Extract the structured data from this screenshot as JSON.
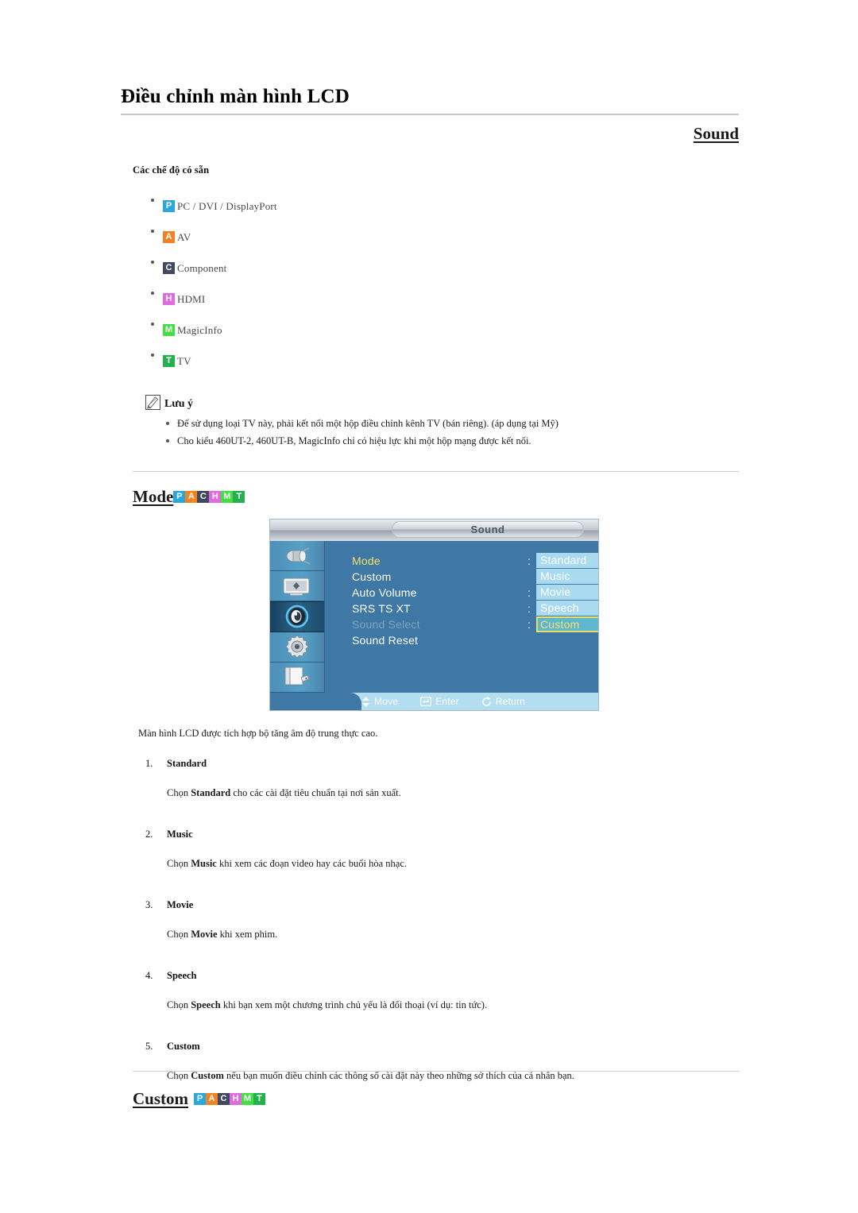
{
  "header": {
    "title": "Điều chỉnh màn hình LCD",
    "section_title": "Sound"
  },
  "available_modes": {
    "heading": "Các chế độ có sẵn",
    "items": [
      {
        "badge": "P",
        "color": "#29a8df",
        "label": "PC / DVI / DisplayPort"
      },
      {
        "badge": "A",
        "color": "#f58220",
        "label": "AV"
      },
      {
        "badge": "C",
        "color": "#41495e",
        "label": "Component"
      },
      {
        "badge": "H",
        "color": "#e06ae0",
        "label": "HDMI"
      },
      {
        "badge": "M",
        "color": "#3fe03f",
        "label": "MagicInfo"
      },
      {
        "badge": "T",
        "color": "#23b14d",
        "label": "TV"
      }
    ]
  },
  "note": {
    "icon": "note-pencil-icon",
    "title": "Lưu ý",
    "items": [
      "Để sử dụng loại TV này, phải kết nối một hộp điều chỉnh kênh TV (bán riêng). (áp dụng tại Mỹ)",
      "Cho kiểu 460UT-2, 460UT-B, MagicInfo chỉ có hiệu lực khi một hộp mạng được kết nối."
    ]
  },
  "badge_set": [
    {
      "letter": "P",
      "color": "#29a8df"
    },
    {
      "letter": "A",
      "color": "#f58220"
    },
    {
      "letter": "C",
      "color": "#41495e"
    },
    {
      "letter": "H",
      "color": "#e06ae0"
    },
    {
      "letter": "M",
      "color": "#3fe03f"
    },
    {
      "letter": "T",
      "color": "#23b14d"
    }
  ],
  "mode_section": {
    "heading": "Mode",
    "intro": "Màn hình LCD được tích hợp bộ tăng âm độ trung thực cao.",
    "items": [
      {
        "index": "1.",
        "name": "Standard",
        "desc_before": "Chọn ",
        "desc_bold": "Standard",
        "desc_after": " cho các cài đặt tiêu chuẩn tại nơi sản xuất."
      },
      {
        "index": "2.",
        "name": "Music",
        "desc_before": "Chọn ",
        "desc_bold": "Music",
        "desc_after": " khi xem các đoạn video hay các buổi hòa nhạc."
      },
      {
        "index": "3.",
        "name": "Movie",
        "desc_before": "Chọn ",
        "desc_bold": "Movie",
        "desc_after": " khi xem phim."
      },
      {
        "index": "4.",
        "name": "Speech",
        "desc_before": "Chọn ",
        "desc_bold": "Speech",
        "desc_after": " khi bạn xem một chương trình chủ yếu là đối thoại (ví dụ: tin tức)."
      },
      {
        "index": "5.",
        "name": "Custom",
        "desc_before": "Chọn ",
        "desc_bold": "Custom",
        "desc_after": " nếu bạn muốn điều chỉnh các thông số cài đặt này theo những sở thích của cá nhân bạn."
      }
    ]
  },
  "custom_section": {
    "heading": "Custom"
  },
  "osd": {
    "title": "Sound",
    "sidebar_icons": [
      "input-source-icon",
      "picture-icon",
      "sound-icon",
      "setup-gear-icon",
      "multi-control-icon"
    ],
    "active_sidebar_index": 2,
    "menu_rows": [
      {
        "label": "Mode",
        "state": "selected",
        "colon": ":"
      },
      {
        "label": "Custom",
        "state": "normal",
        "colon": ""
      },
      {
        "label": "Auto Volume",
        "state": "normal",
        "colon": ":"
      },
      {
        "label": "SRS TS XT",
        "state": "normal",
        "colon": ":"
      },
      {
        "label": "Sound Select",
        "state": "disabled",
        "colon": ":"
      },
      {
        "label": "Sound Reset",
        "state": "normal",
        "colon": ""
      }
    ],
    "options": [
      {
        "label": "Standard",
        "selected": false
      },
      {
        "label": "Music",
        "selected": false
      },
      {
        "label": "Movie",
        "selected": false
      },
      {
        "label": "Speech",
        "selected": false
      },
      {
        "label": "Custom",
        "selected": true
      }
    ],
    "footer": [
      {
        "icon": "move-updown-icon",
        "label": "Move"
      },
      {
        "icon": "enter-key-icon",
        "label": "Enter"
      },
      {
        "icon": "return-arrow-icon",
        "label": "Return"
      }
    ]
  }
}
